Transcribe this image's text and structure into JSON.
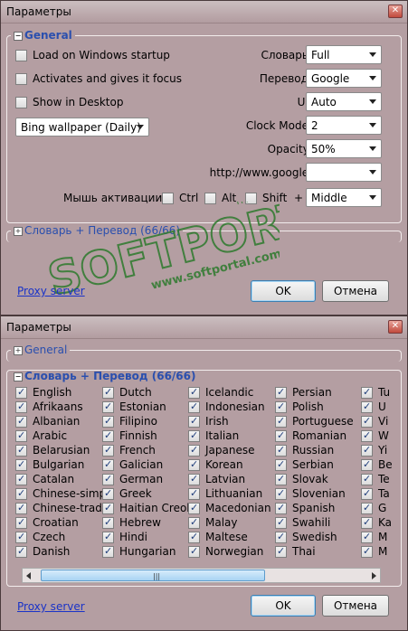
{
  "window1": {
    "title": "Параметры",
    "general_label": "General",
    "checkboxes": [
      {
        "label": "Load on Windows startup",
        "checked": false
      },
      {
        "label": "Activates and gives it focus",
        "checked": false
      },
      {
        "label": "Show in Desktop",
        "checked": false
      }
    ],
    "wallpaper": "Bing wallpaper (Daily)",
    "settings": [
      {
        "label": "Словарь:",
        "value": "Full"
      },
      {
        "label": "Перевод:",
        "value": "Google"
      },
      {
        "label": "UI:",
        "value": "Auto"
      },
      {
        "label": "Clock Mode:",
        "value": "2"
      },
      {
        "label": "Opacity:",
        "value": "50%"
      },
      {
        "label": "http://www.google.",
        "value": ""
      }
    ],
    "mouse_label": "Мышь активации:",
    "modifiers": [
      {
        "label": "Ctrl",
        "checked": false
      },
      {
        "label": "Alt",
        "checked": false
      },
      {
        "label": "Shift",
        "checked": false
      }
    ],
    "plus": "+",
    "mouse_button": "Middle",
    "dict_group_label": "Словарь + Перевод (66/66)",
    "proxy": "Proxy server",
    "ok": "OK",
    "cancel": "Отмена",
    "watermark_brand": "SOFTPORTAL",
    "watermark_tm": "TM",
    "watermark_url": "www.softportal.com"
  },
  "window2": {
    "title": "Параметры",
    "general_label": "General",
    "dict_group_label": "Словарь + Перевод (66/66)",
    "languages": [
      [
        "English",
        "Afrikaans",
        "Albanian",
        "Arabic",
        "Belarusian",
        "Bulgarian",
        "Catalan",
        "Chinese-simp",
        "Chinese-trad",
        "Croatian",
        "Czech",
        "Danish"
      ],
      [
        "Dutch",
        "Estonian",
        "Filipino",
        "Finnish",
        "French",
        "Galician",
        "German",
        "Greek",
        "Haitian Creole",
        "Hebrew",
        "Hindi",
        "Hungarian"
      ],
      [
        "Icelandic",
        "Indonesian",
        "Irish",
        "Italian",
        "Japanese",
        "Korean",
        "Latvian",
        "Lithuanian",
        "Macedonian",
        "Malay",
        "Maltese",
        "Norwegian"
      ],
      [
        "Persian",
        "Polish",
        "Portuguese",
        "Romanian",
        "Russian",
        "Serbian",
        "Slovak",
        "Slovenian",
        "Spanish",
        "Swahili",
        "Swedish",
        "Thai"
      ],
      [
        "Tu",
        "U",
        "Vi",
        "W",
        "Yi",
        "Be",
        "Te",
        "Ta",
        "G",
        "Ka",
        "M",
        "M"
      ]
    ],
    "proxy": "Proxy server",
    "ok": "OK",
    "cancel": "Отмена"
  },
  "colors": {
    "window_bg": "#b49ea2",
    "group_title": "#2a4fae",
    "link": "#1a33c8",
    "watermark": "#2d7a2d"
  }
}
